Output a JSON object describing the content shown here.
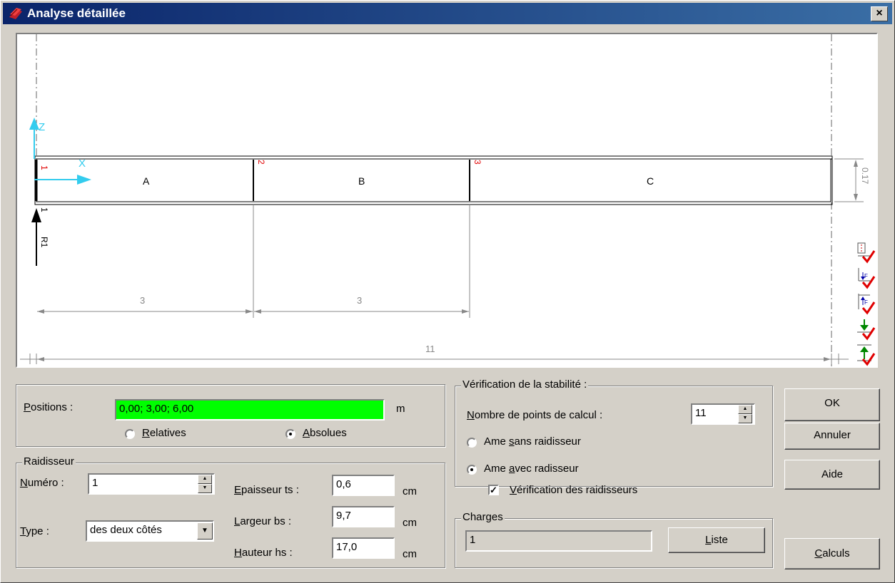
{
  "window": {
    "title": "Analyse détaillée",
    "close_glyph": "×"
  },
  "drawing": {
    "axis_z": "Z",
    "axis_x": "X",
    "segments": [
      "A",
      "B",
      "C"
    ],
    "node_labels": [
      "1",
      "2",
      "3"
    ],
    "support_number": "1",
    "reaction_label": "R1",
    "height_dim": "0.17",
    "span_dims": [
      "3",
      "3"
    ],
    "total_dim": "11"
  },
  "toolbar_icons": [
    "section-check-icon",
    "load-down-check-icon",
    "load-up-check-icon",
    "green-arrow-down-check-icon",
    "green-arrow-up-check-icon"
  ],
  "positions": {
    "label": "Positions :",
    "value": "0,00; 3,00; 6,00",
    "unit": "m",
    "relatives": "Relatives",
    "absolues": "Absolues",
    "selected": "absolues",
    "highlight_color": "#00ff00"
  },
  "raidisseur": {
    "legend": "Raidisseur",
    "numero_label": "Numéro :",
    "numero_value": "1",
    "type_label": "Type :",
    "type_value": "des deux côtés",
    "epaisseur_label": "Epaisseur ts :",
    "epaisseur_value": "0,6",
    "largeur_label": "Largeur bs :",
    "largeur_value": "9,7",
    "hauteur_label": "Hauteur hs :",
    "hauteur_value": "17,0",
    "unit": "cm"
  },
  "stabilite": {
    "legend": "Vérification de la stabilité :",
    "nb_points_label": "Nombre de points de calcul :",
    "nb_points_value": "11",
    "sans": "Ame sans raidisseur",
    "avec": "Ame avec radisseur",
    "verif": "Vérification des raidisseurs",
    "selected": "avec",
    "verif_checked": true
  },
  "charges": {
    "legend": "Charges",
    "value": "1",
    "liste_label": "Liste"
  },
  "buttons": {
    "ok": "OK",
    "annuler": "Annuler",
    "aide": "Aide",
    "calculs": "Calculs"
  }
}
